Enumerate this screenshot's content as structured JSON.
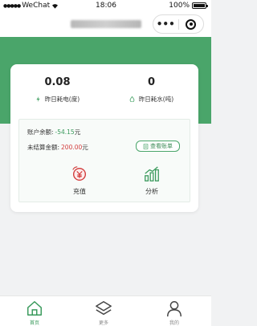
{
  "status_bar": {
    "carrier": "WeChat",
    "signal": "●●●●●",
    "time": "18:06",
    "battery": "100%"
  },
  "nav": {
    "menu_glyph": "•••"
  },
  "stats": {
    "electricity": {
      "value": "0.08",
      "label": "昨日耗电(度)",
      "icon": "electricity-icon"
    },
    "water": {
      "value": "0",
      "label": "昨日耗水(吨)",
      "icon": "water-drop-icon"
    }
  },
  "account": {
    "balance_label": "账户余额:",
    "balance_value": "-54.15",
    "balance_unit": "元",
    "unsettled_label": "未结算金额:",
    "unsettled_value": "200.00",
    "unsettled_unit": "元",
    "bill_button": "查看账单"
  },
  "actions": {
    "recharge": "充值",
    "analysis": "分析"
  },
  "tabbar": {
    "home": "首页",
    "more": "更多",
    "mine": "我的"
  },
  "colors": {
    "brand_green": "#4aa56a",
    "negative_red": "#d23a3a"
  }
}
